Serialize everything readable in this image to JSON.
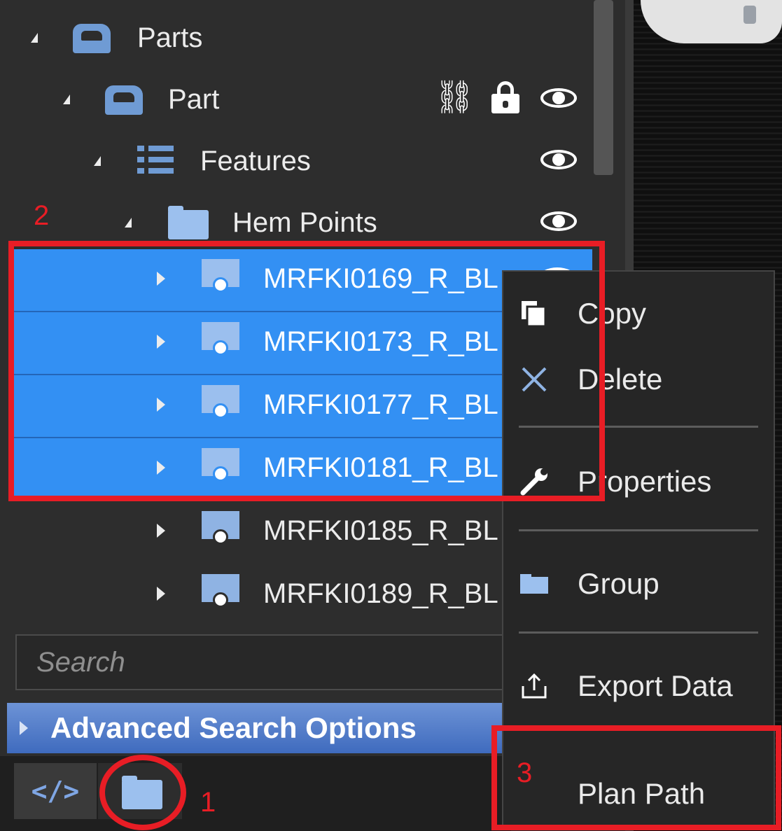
{
  "tree": {
    "items": [
      {
        "label": "Parts",
        "level": 0
      },
      {
        "label": "Part",
        "level": 1
      },
      {
        "label": "Features",
        "level": 2
      },
      {
        "label": "Hem Points",
        "level": 3
      },
      {
        "label": "MRFKI0169_R_BL",
        "selected": true
      },
      {
        "label": "MRFKI0173_R_BL",
        "selected": true
      },
      {
        "label": "MRFKI0177_R_BL",
        "selected": true
      },
      {
        "label": "MRFKI0181_R_BL",
        "selected": true
      },
      {
        "label": "MRFKI0185_R_BL",
        "selected": false
      },
      {
        "label": "MRFKI0189_R_BL",
        "selected": false
      }
    ]
  },
  "search": {
    "placeholder": "Search"
  },
  "advanced_search": {
    "label": "Advanced Search Options"
  },
  "bottom_tabs": {
    "code_glyph": "</>"
  },
  "context_menu": {
    "copy": "Copy",
    "delete": "Delete",
    "properties": "Properties",
    "group": "Group",
    "export": "Export Data",
    "plan_path": "Plan Path"
  },
  "annotations": {
    "one": "1",
    "two": "2",
    "three": "3"
  },
  "colors": {
    "selection": "#3390f3",
    "annotation_red": "#e81d25",
    "panel_bg": "#2d2d2d"
  }
}
